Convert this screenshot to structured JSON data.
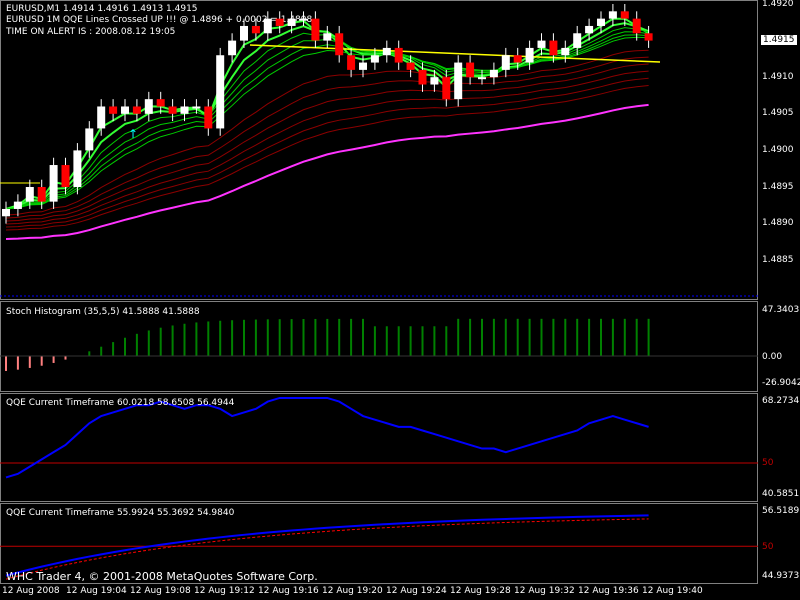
{
  "header": {
    "line1": "EURUSD,M1  1.4914 1.4916 1.4913 1.4915",
    "line2": "EURUSD 1M   QQE Lines Crossed UP !!!   @   1.4896  + 0.0002 = 1.4898",
    "line3": "TIME ON ALERT IS : 2008.08.12 19:05"
  },
  "main_axis": {
    "ticks": [
      "1.4920",
      "1.4915",
      "1.4910",
      "1.4905",
      "1.4900",
      "1.4895",
      "1.4890",
      "1.4885"
    ],
    "current_price": "1.4915"
  },
  "stoch": {
    "label": "Stoch Histogram (35,5,5) 41.5888 41.5888",
    "ticks": [
      "47.3403",
      "0.00",
      "-26.9042"
    ]
  },
  "qqe1": {
    "label": "QQE Current Timeframe 60.0218 58.6508 56.4944",
    "ticks": [
      "68.2734",
      "40.5851"
    ],
    "level": "50"
  },
  "qqe2": {
    "label": "QQE Current Timeframe 55.9924 55.3692 54.9840",
    "ticks": [
      "56.5189",
      "44.9373"
    ],
    "level": "50"
  },
  "watermark": "WHC Trader 4, © 2001-2008 MetaQuotes Software Corp.",
  "time_axis": [
    "12 Aug 2008",
    "12 Aug 19:04",
    "12 Aug 19:08",
    "12 Aug 19:12",
    "12 Aug 19:16",
    "12 Aug 19:20",
    "12 Aug 19:24",
    "12 Aug 19:28",
    "12 Aug 19:32",
    "12 Aug 19:36",
    "12 Aug 19:40"
  ],
  "colors": {
    "bull": "#ffffff",
    "bear": "#ff0000",
    "ema_bright": "#33ff33",
    "ema_dark": "#006600",
    "red_band": "#8b0000",
    "magenta": "#ff33ff",
    "yellow": "#ffff00",
    "stoch_pos": "#008000",
    "stoch_neg": "#ff8080",
    "qqe_blue": "#0000ff",
    "level_red": "#c00000",
    "alert_arrow": "#00ffff"
  },
  "chart_data": {
    "type": "candlestick",
    "closes": [
      1.4892,
      1.4893,
      1.4895,
      1.4893,
      1.4898,
      1.4895,
      1.49,
      1.4903,
      1.4906,
      1.4905,
      1.4906,
      1.4905,
      1.4907,
      1.4906,
      1.4905,
      1.4906,
      1.4906,
      1.4903,
      1.4913,
      1.4915,
      1.4917,
      1.4916,
      1.4918,
      1.4917,
      1.4918,
      1.4918,
      1.4915,
      1.4916,
      1.4913,
      1.4911,
      1.4912,
      1.4913,
      1.4914,
      1.4912,
      1.4911,
      1.4909,
      1.491,
      1.4907,
      1.4912,
      1.491,
      1.491,
      1.4911,
      1.4913,
      1.4912,
      1.4914,
      1.4915,
      1.4913,
      1.4914,
      1.4916,
      1.4917,
      1.4918,
      1.4919,
      1.4918,
      1.4916,
      1.4915
    ]
  }
}
